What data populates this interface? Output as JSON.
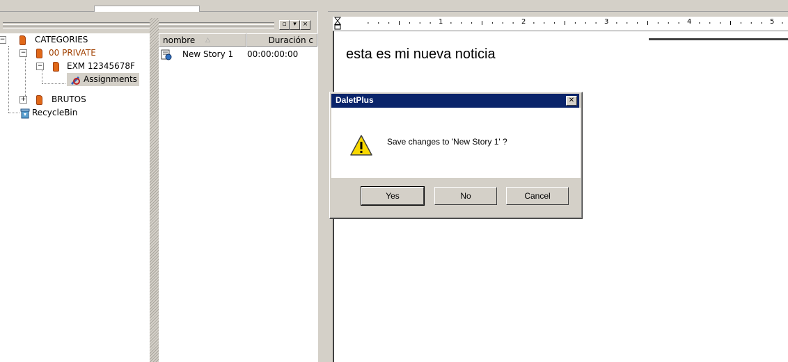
{
  "tree": {
    "items": [
      {
        "label": "CATEGORIES"
      },
      {
        "label": "00 PRIVATE"
      },
      {
        "label": "EXM 12345678F"
      },
      {
        "label": "Assignments"
      },
      {
        "label": "BRUTOS"
      },
      {
        "label": "RecycleBin"
      }
    ]
  },
  "list": {
    "columns": [
      "nombre",
      "Duración c"
    ],
    "rows": [
      {
        "nombre": "New Story 1",
        "duracion": "00:00:00:00"
      }
    ]
  },
  "ruler": {
    "numbers": [
      "1",
      "2",
      "3",
      "4",
      "5"
    ]
  },
  "editor": {
    "text": "esta es mi nueva noticia"
  },
  "dialog": {
    "title": "DaletPlus",
    "message": "Save changes to 'New Story 1' ?",
    "buttons": {
      "yes": "Yes",
      "no": "No",
      "cancel": "Cancel"
    }
  },
  "colors": {
    "titlebar": "#0a246a",
    "private_folder_text": "#a04000",
    "folder": "#e06818"
  }
}
